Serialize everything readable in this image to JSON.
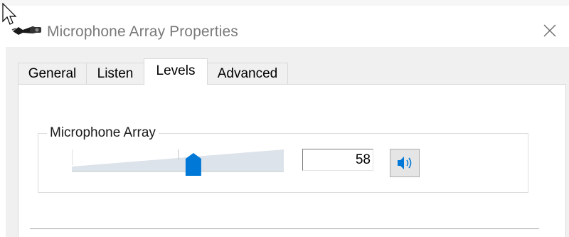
{
  "window": {
    "title": "Microphone Array Properties"
  },
  "tabs": [
    {
      "label": "General",
      "active": false
    },
    {
      "label": "Listen",
      "active": false
    },
    {
      "label": "Levels",
      "active": true
    },
    {
      "label": "Advanced",
      "active": false
    }
  ],
  "levels": {
    "group_label": "Microphone Array",
    "slider": {
      "value": 58,
      "min": 0,
      "max": 100
    },
    "value_text": "58"
  },
  "icons": {
    "titlebar": "microphone-array-icon",
    "close": "close-icon",
    "speaker": "speaker-icon",
    "cursor": "mouse-pointer-icon"
  },
  "colors": {
    "accent": "#0078d7",
    "title_text": "#7a7a7a",
    "dialog_body": "#f0f0f0"
  }
}
